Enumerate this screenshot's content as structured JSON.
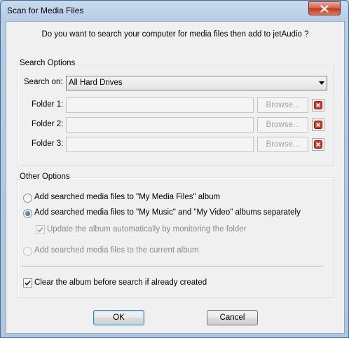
{
  "window": {
    "title": "Scan for Media Files"
  },
  "question": "Do you want to search your computer for media files then add to jetAudio ?",
  "search_options": {
    "legend": "Search Options",
    "search_on_label": "Search on:",
    "search_on_value": "All Hard Drives",
    "folders": [
      {
        "label": "Folder 1:",
        "value": "",
        "browse_label": "Browse..."
      },
      {
        "label": "Folder 2:",
        "value": "",
        "browse_label": "Browse..."
      },
      {
        "label": "Folder 3:",
        "value": "",
        "browse_label": "Browse..."
      }
    ]
  },
  "other_options": {
    "legend": "Other Options",
    "radio_my_media": {
      "label": "Add searched media files to \"My Media Files\" album",
      "selected": false
    },
    "radio_separately": {
      "label": "Add searched media files to \"My Music\" and \"My Video\" albums separately",
      "selected": true
    },
    "check_update": {
      "label": "Update the album automatically by monitoring the folder",
      "checked": true,
      "enabled": false
    },
    "radio_current": {
      "label": "Add searched media files to the current album",
      "selected": false,
      "enabled": false
    },
    "check_clear": {
      "label": "Clear the album before search if already created",
      "checked": true
    }
  },
  "buttons": {
    "ok": "OK",
    "cancel": "Cancel"
  },
  "colors": {
    "close_button": "#c7442a",
    "default_button_border": "#3c7fb1",
    "titlebar": "#b9d1ea"
  }
}
